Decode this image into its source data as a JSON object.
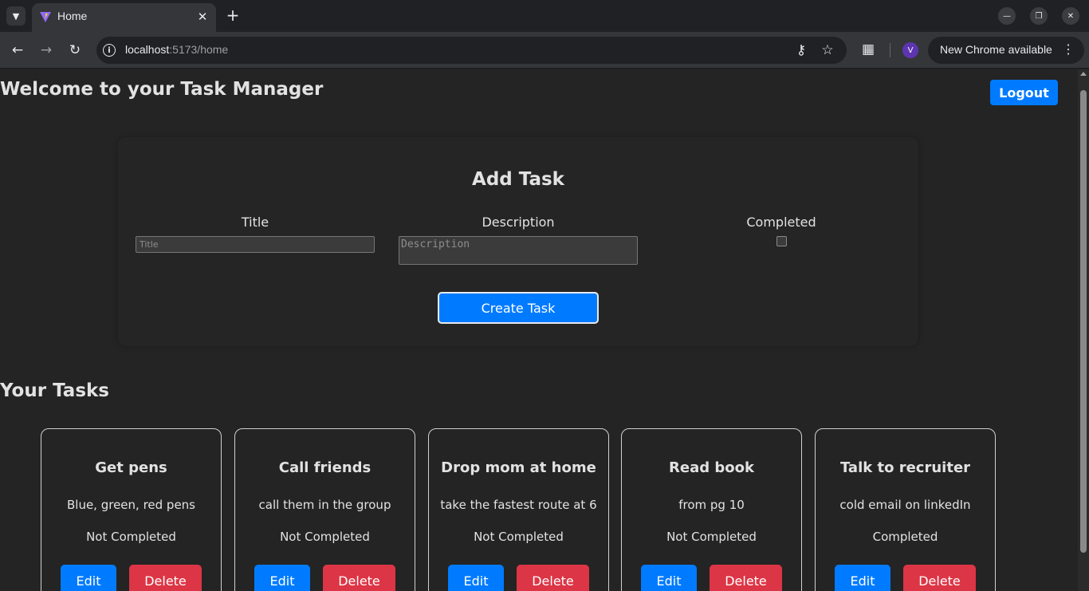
{
  "browser": {
    "tab_title": "Home",
    "url_host": "localhost",
    "url_rest": ":5173/home",
    "avatar_letter": "V",
    "update_label": "New Chrome available",
    "icons": {
      "tab_search": "chevron-down-icon",
      "close_tab": "close-icon",
      "new_tab": "plus-icon",
      "back": "arrow-left-icon",
      "forward": "arrow-right-icon",
      "reload": "reload-icon",
      "site_info": "info-icon",
      "password": "key-icon",
      "bookmark": "star-icon",
      "extensions": "puzzle-icon",
      "menu": "more-vert-icon"
    }
  },
  "header": {
    "title": "Welcome to your Task Manager",
    "logout_label": "Logout"
  },
  "add_task": {
    "heading": "Add Task",
    "title_label": "Title",
    "title_placeholder": "Title",
    "title_value": "",
    "description_label": "Description",
    "description_placeholder": "Description",
    "description_value": "",
    "completed_label": "Completed",
    "completed_checked": false,
    "submit_label": "Create Task"
  },
  "tasks_section": {
    "heading": "Your Tasks",
    "edit_label": "Edit",
    "delete_label": "Delete",
    "tasks": [
      {
        "title": "Get pens",
        "description": "Blue, green, red pens",
        "status": "Not Completed"
      },
      {
        "title": "Call friends",
        "description": "call them in the group",
        "status": "Not Completed"
      },
      {
        "title": "Drop mom at home",
        "description": "take the fastest route at 6",
        "status": "Not Completed"
      },
      {
        "title": "Read book",
        "description": "from pg 10",
        "status": "Not Completed"
      },
      {
        "title": "Talk to recruiter",
        "description": "cold email on linkedIn",
        "status": "Completed"
      }
    ]
  },
  "colors": {
    "primary": "#007bff",
    "danger": "#dc3545",
    "page_background": "#242424",
    "text": "#dedede"
  }
}
